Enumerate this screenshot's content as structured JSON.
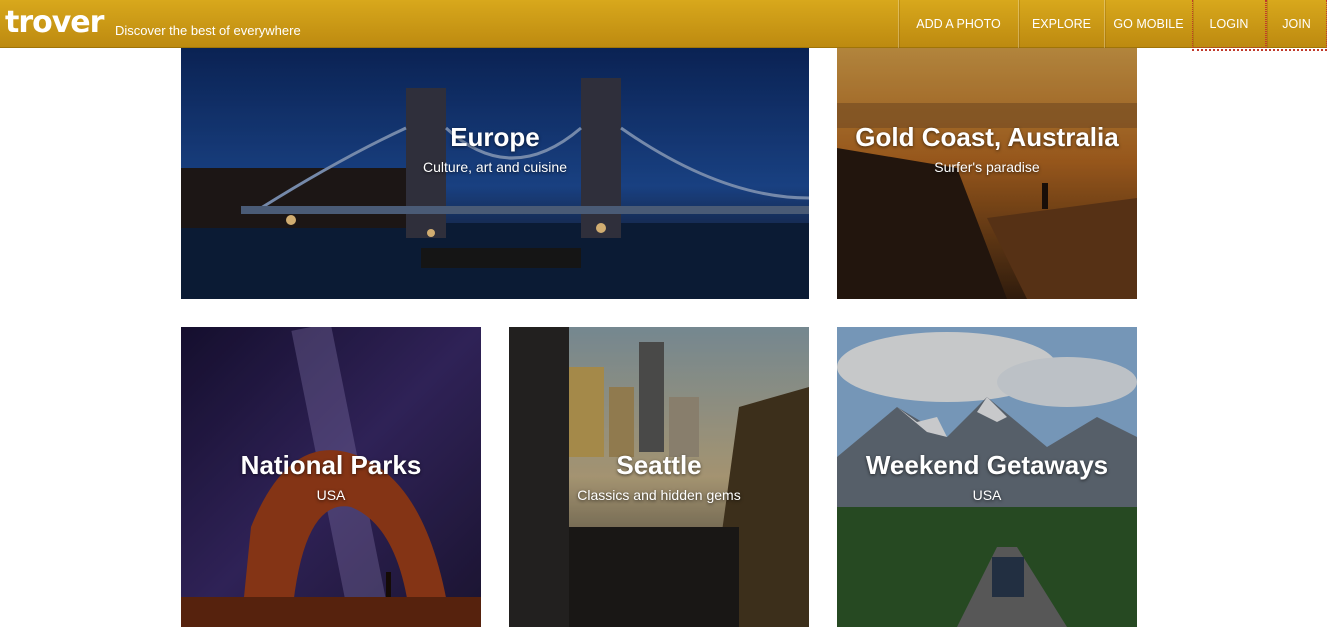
{
  "header": {
    "logo": "trover",
    "tagline": "Discover the best of everywhere",
    "nav": [
      "ADD A PHOTO",
      "EXPLORE",
      "GO MOBILE",
      "LOGIN",
      "JOIN"
    ]
  },
  "tiles": [
    {
      "title": "Europe",
      "subtitle": "Culture, art and cuisine"
    },
    {
      "title": "Gold Coast, Australia",
      "subtitle": "Surfer's paradise"
    },
    {
      "title": "National Parks",
      "subtitle": "USA"
    },
    {
      "title": "Seattle",
      "subtitle": "Classics and hidden gems"
    },
    {
      "title": "Weekend Getaways",
      "subtitle": "USA"
    }
  ],
  "colors": {
    "header": "#c9960f",
    "text": "#ffffff"
  }
}
